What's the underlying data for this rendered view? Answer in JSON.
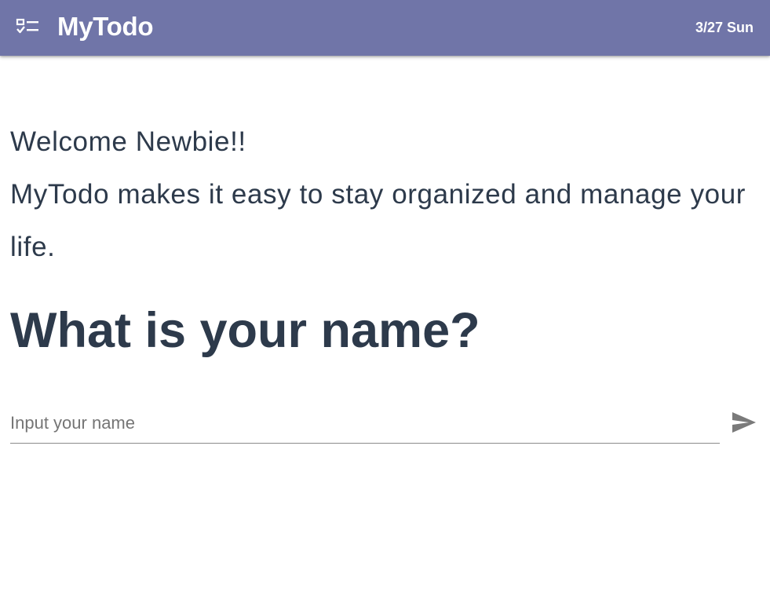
{
  "header": {
    "app_icon": "checklist-icon",
    "title": "MyTodo",
    "date": "3/27 Sun",
    "background_color": "#7075a8"
  },
  "welcome": {
    "greeting": "Welcome Newbie!!",
    "intro": "MyTodo makes it easy to stay organized and manage your life."
  },
  "name_prompt": {
    "question": "What is your name?",
    "input_placeholder": "Input your name",
    "input_value": "",
    "send_icon": "send-icon"
  },
  "colors": {
    "text": "#2d3a4b",
    "placeholder": "#757575",
    "underline": "#8a8a8a",
    "send_icon": "#7a7a7a"
  }
}
